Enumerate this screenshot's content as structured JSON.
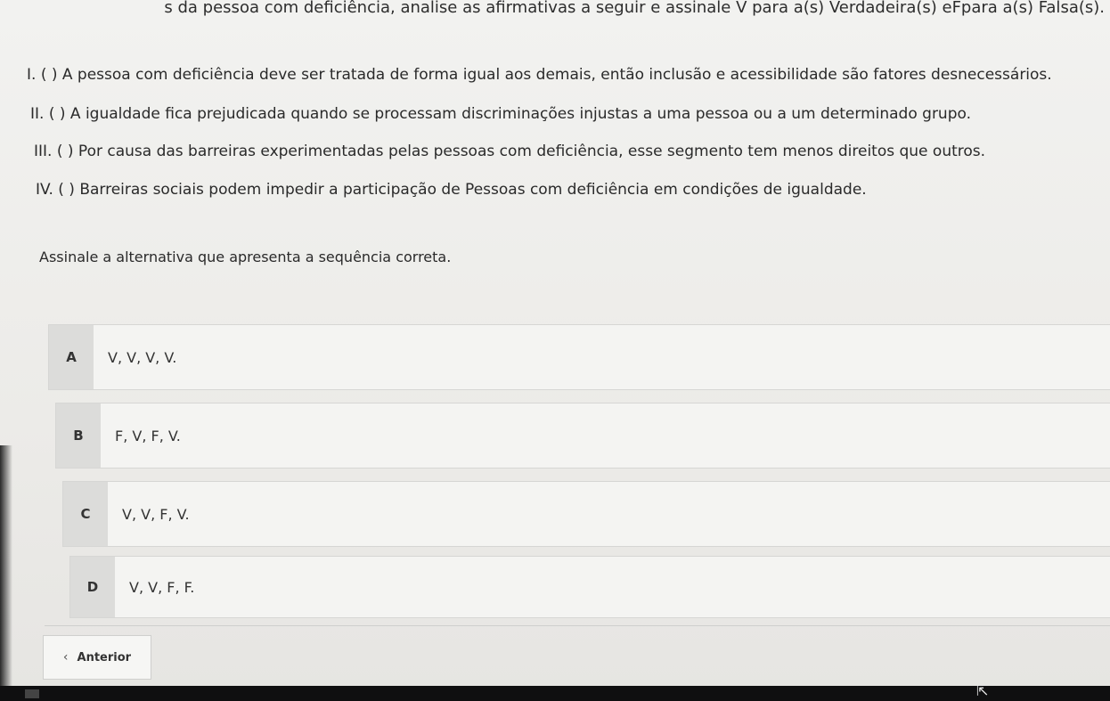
{
  "question": {
    "header_fragment": "s da pessoa com deficiência, analise as afirmativas a seguir e assinale V para a(s) Verdadeira(s) eFpara a(s) Falsa(s).",
    "statements": [
      "I. ( ) A pessoa com deficiência deve ser tratada de forma igual aos demais, então inclusão e acessibilidade são fatores desnecessários.",
      "II. ( ) A igualdade fica prejudicada quando se processam discriminações injustas a uma pessoa ou a um determinado grupo.",
      "III. ( ) Por causa das barreiras experimentadas pelas pessoas com deficiência, esse segmento tem menos direitos que outros.",
      "IV. ( ) Barreiras sociais podem impedir a participação de Pessoas com deficiência em condições de igualdade."
    ],
    "instruction": "Assinale a alternativa que apresenta a sequência correta."
  },
  "options": [
    {
      "letter": "A",
      "text": "V, V, V, V."
    },
    {
      "letter": "B",
      "text": "F, V, F, V."
    },
    {
      "letter": "C",
      "text": "V, V, F, V."
    },
    {
      "letter": "D",
      "text": "V, V, F, F."
    }
  ],
  "navigation": {
    "back_label": "Anterior",
    "back_icon": "chevron-left-icon"
  },
  "colors": {
    "page_background": "#eeeeec",
    "option_letter_background": "#dcdcda",
    "taskbar": "#0f0f10"
  }
}
